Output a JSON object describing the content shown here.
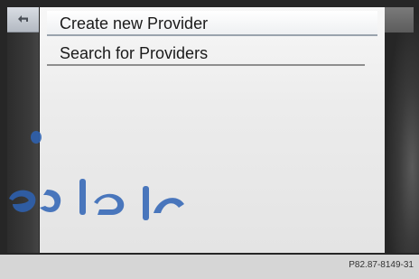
{
  "menu": {
    "items": [
      {
        "label": "Create new Provider",
        "selected": true
      },
      {
        "label": "Search for Providers",
        "selected": false
      }
    ]
  },
  "icons": {
    "back": "back-arrow-icon"
  },
  "watermark": {
    "text": "امدادخو"
  },
  "footer": {
    "code": "P82.87-8149-31"
  },
  "colors": {
    "panel": "#ececec",
    "frame": "#262626",
    "watermark": "#2e63b5"
  }
}
